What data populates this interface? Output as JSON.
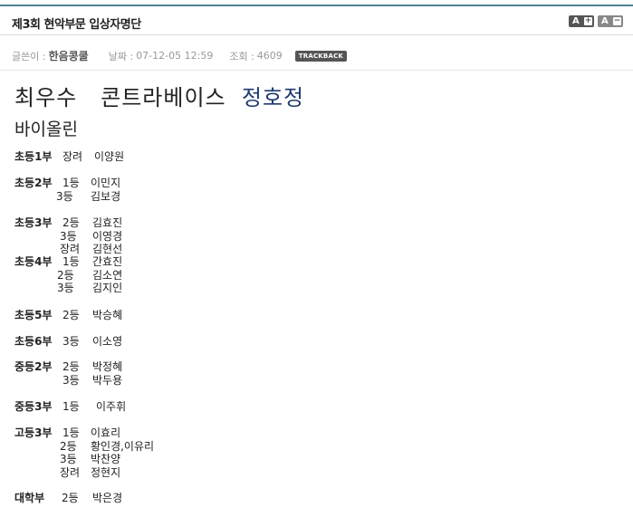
{
  "header": {
    "title": "제3회 현악부문 입상자명단"
  },
  "font_controls": {
    "increase_label": "A",
    "increase_sign": "+",
    "decrease_label": "A",
    "decrease_sign": "−"
  },
  "meta": {
    "author_label": "글쓴이 :",
    "author": "한음콩쿨",
    "date_label": "날짜 :",
    "date": "07-12-05 12:59",
    "views_label": "조회 :",
    "views": "4609",
    "trackback": "TRACKBACK"
  },
  "best": {
    "label": "최우수",
    "instrument": "콘트라베이스",
    "name": "정호정"
  },
  "section": "바이올린",
  "results": [
    {
      "group": "초등1부",
      "entries": [
        {
          "rank": "장려",
          "name": "이양원"
        }
      ]
    },
    {
      "group": "초등2부",
      "entries": [
        {
          "rank": "1등",
          "name": "이민지"
        },
        {
          "rank": "3등",
          "name": "김보경"
        }
      ]
    },
    {
      "group": "초등3부",
      "entries": [
        {
          "rank": "2등",
          "name": "김효진"
        },
        {
          "rank": "3등",
          "name": "이영경"
        },
        {
          "rank": "장려",
          "name": "김현선"
        }
      ]
    },
    {
      "group": "초등4부",
      "entries": [
        {
          "rank": "1등",
          "name": "간효진"
        },
        {
          "rank": "2등",
          "name": "김소연"
        },
        {
          "rank": "3등",
          "name": "김지인"
        }
      ]
    },
    {
      "group": "초등5부",
      "entries": [
        {
          "rank": "2등",
          "name": "박승혜"
        }
      ]
    },
    {
      "group": "초등6부",
      "entries": [
        {
          "rank": "3등",
          "name": "이소영"
        }
      ]
    },
    {
      "group": "중등2부",
      "entries": [
        {
          "rank": "2등",
          "name": "박정혜"
        },
        {
          "rank": "3등",
          "name": "박두용"
        }
      ]
    },
    {
      "group": "중등3부",
      "entries": [
        {
          "rank": "1등",
          "name": "이주휘"
        }
      ]
    },
    {
      "group": "고등3부",
      "entries": [
        {
          "rank": "1등",
          "name": "이효리"
        },
        {
          "rank": "2등",
          "name": "황인경,이유리"
        },
        {
          "rank": "3등",
          "name": "박찬양"
        },
        {
          "rank": "장려",
          "name": "정현지"
        }
      ]
    },
    {
      "group": "대학부",
      "entries": [
        {
          "rank": "2등",
          "name": "박은경"
        }
      ]
    }
  ]
}
